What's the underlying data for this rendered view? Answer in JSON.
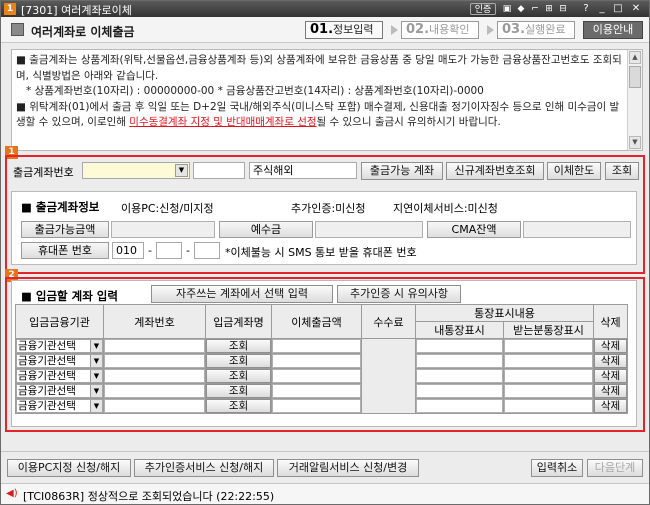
{
  "window": {
    "code": "[7301]",
    "title": "여러계좌로이체",
    "link_label": "인증",
    "controls": [
      "?",
      "_",
      "□",
      "✕"
    ]
  },
  "header": {
    "title": "여러계좌로 이체출금",
    "steps": [
      {
        "num": "01.",
        "label": "정보입력",
        "active": true
      },
      {
        "num": "02.",
        "label": "내용확인",
        "active": false
      },
      {
        "num": "03.",
        "label": "실행완료",
        "active": false
      }
    ],
    "guide_button": "이용안내"
  },
  "notice": {
    "p1": "■ 출금계좌는 상품계좌(위탁,선물옵션,금융상품계좌 등)외 상품계좌에 보유한 금융상품 중 당일 매도가 가능한 금융상품잔고번호도 조회되며, 식별방법은 아래와 같습니다.",
    "p1_detail": "* 상품계좌번호(10자리) : 00000000-00 * 금융상품잔고번호(14자리) : 상품계좌번호(10자리)-0000",
    "p2_before": "■ 위탁계좌(01)에서 출금 후 익일 또는 D+2일 국내/해외주식(미니스탁 포함) 매수결제, 신용대출 정기이자징수 등으로 인해 미수금이 발생할 수 있으며, 이로인해 ",
    "p2_red": "미수동결계좌 지정 및 반대매매계좌로 선정",
    "p2_after": "될 수 있으니 출금시 유의하시기 바랍니다."
  },
  "section1": {
    "num": "1",
    "account_label": "출금계좌번호",
    "account_name": "주식해외",
    "buttons": [
      "출금가능 계좌",
      "신규계좌번호조회",
      "이체한도",
      "조회"
    ],
    "info": {
      "title": "■ 출금계좌정보",
      "pc_status": "이용PC:신청/미지정",
      "auth_status": "추가인증:미신청",
      "region_status": "지연이체서비스:미신청",
      "labels": {
        "available": "출금가능금액",
        "deposit": "예수금",
        "cma": "CMA잔액",
        "phone": "휴대폰 번호"
      },
      "phone_prefix": "010",
      "phone_sep": "-",
      "phone_note": "*이체불능 시 SMS 통보 받을 휴대폰 번호"
    }
  },
  "section2": {
    "num": "2",
    "title": "■ 입금할 계좌 입력",
    "frequent_button": "자주쓰는 계좌에서 선택 입력",
    "caution_button": "추가인증 시 유의사항",
    "columns": [
      "입금금융기관",
      "계좌번호",
      "입금계좌명",
      "이체출금액",
      "수수료",
      "통장표시내용",
      "삭제"
    ],
    "subcolumns": [
      "내통장표시",
      "받는분통장표시"
    ],
    "rows": [
      {
        "bank": "금융기관선택",
        "lookup": "조회",
        "delete": "삭제"
      },
      {
        "bank": "금융기관선택",
        "lookup": "조회",
        "delete": "삭제"
      },
      {
        "bank": "금융기관선택",
        "lookup": "조회",
        "delete": "삭제"
      },
      {
        "bank": "금융기관선택",
        "lookup": "조회",
        "delete": "삭제"
      },
      {
        "bank": "금융기관선택",
        "lookup": "조회",
        "delete": "삭제"
      }
    ]
  },
  "footer": {
    "buttons": [
      "이용PC지정 신청/해지",
      "추가인증서비스 신청/해지",
      "거래알림서비스 신청/변경"
    ],
    "cancel": "입력취소",
    "next": "다음단계"
  },
  "status": {
    "text": "[TCI0863R] 정상적으로 조회되었습니다 (22:22:55)"
  },
  "colors": {
    "accent": "#e8731a",
    "highlight": "#e3242b",
    "notice_red": "#e0141e"
  }
}
